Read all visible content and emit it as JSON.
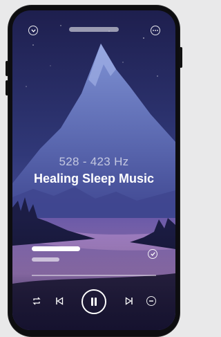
{
  "player": {
    "frequency": "528 - 423 Hz",
    "title": "Healing Sleep Music",
    "progress": 0
  },
  "icons": {
    "collapse": "chevron-down-icon",
    "more": "more-icon",
    "added": "check-circle-icon",
    "repeat": "repeat-icon",
    "previous": "skip-previous-icon",
    "pause": "pause-icon",
    "next": "skip-next-icon",
    "remove": "remove-circle-icon"
  },
  "colors": {
    "sky_top": "#1f2152",
    "mountain": "#6678c0",
    "lake": "#b58ad6"
  }
}
